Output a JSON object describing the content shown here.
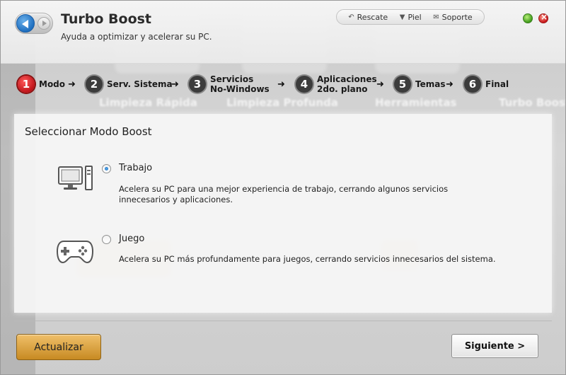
{
  "app": {
    "title": "Turbo Boost",
    "subtitle": "Ayuda a optimizar y acelerar su PC."
  },
  "toplinks": [
    {
      "label": "Rescate",
      "icon": "undo-arrow-icon"
    },
    {
      "label": "Piel",
      "icon": "shirt-icon"
    },
    {
      "label": "Soporte",
      "icon": "mail-icon"
    }
  ],
  "steps": [
    {
      "num": "1",
      "label": "Modo",
      "active": true
    },
    {
      "num": "2",
      "label": "Serv. Sistema"
    },
    {
      "num": "3",
      "label": "Servicios",
      "label2": "No-Windows"
    },
    {
      "num": "4",
      "label": "Aplicaciones",
      "label2": "2do. plano"
    },
    {
      "num": "5",
      "label": "Temas"
    },
    {
      "num": "6",
      "label": "Final"
    }
  ],
  "panel": {
    "title": "Seleccionar Modo Boost",
    "options": [
      {
        "title": "Trabajo",
        "selected": true,
        "icon": "computer-icon",
        "desc": "Acelera su PC para una mejor experiencia de trabajo, cerrando algunos servicios innecesarios y aplicaciones."
      },
      {
        "title": "Juego",
        "selected": false,
        "icon": "gamepad-icon",
        "desc": "Acelera su PC más profundamente para juegos, cerrando servicios innecesarios  del sistema."
      }
    ]
  },
  "buttons": {
    "update": "Actualizar",
    "next": "Siguiente >"
  },
  "colors": {
    "active_step": "#c0141a",
    "update_button": "#e0a640",
    "radio_selected": "#1a64b4"
  }
}
